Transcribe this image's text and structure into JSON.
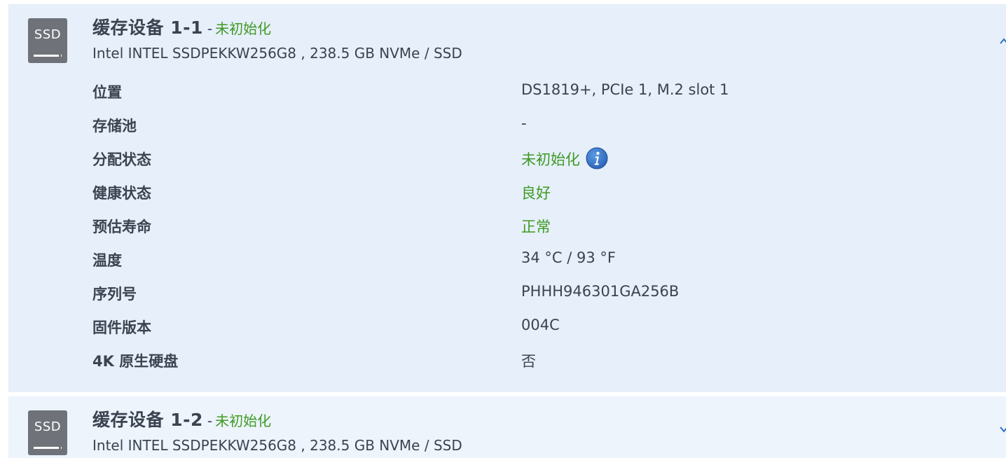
{
  "devices": [
    {
      "icon_label": "SSD",
      "name": "缓存设备 1-1",
      "separator": "-",
      "status": "未初始化",
      "description": "Intel INTEL SSDPEKKW256G8 , 238.5 GB NVMe / SSD",
      "expanded": true,
      "properties": [
        {
          "label": "位置",
          "value": "DS1819+, PCIe 1, M.2 slot 1"
        },
        {
          "label": "存储池",
          "value": "-"
        },
        {
          "label": "分配状态",
          "value": "未初始化"
        },
        {
          "label": "健康状态",
          "value": "良好"
        },
        {
          "label": "预估寿命",
          "value": "正常"
        },
        {
          "label": "温度",
          "value": "34 °C / 93 °F"
        },
        {
          "label": "序列号",
          "value": "PHHH946301GA256B"
        },
        {
          "label": "固件版本",
          "value": "004C"
        },
        {
          "label": "4K 原生硬盘",
          "value": "否"
        }
      ]
    },
    {
      "icon_label": "SSD",
      "name": "缓存设备 1-2",
      "separator": "-",
      "status": "未初始化",
      "description": "Intel INTEL SSDPEKKW256G8 , 238.5 GB NVMe / SSD",
      "expanded": false
    }
  ],
  "colors": {
    "expanded_bg": "#e6effa",
    "collapsed_bg": "#edf4fc",
    "text": "#3b4350",
    "status_green": "#3f9a24",
    "info_blue": "#2f6fc4",
    "icon_gray": "#6f7379"
  },
  "icons": {
    "device": "ssd-drive-icon",
    "info": "info-icon",
    "expand_up": "chevron-up-icon",
    "expand_down": "chevron-down-icon"
  }
}
